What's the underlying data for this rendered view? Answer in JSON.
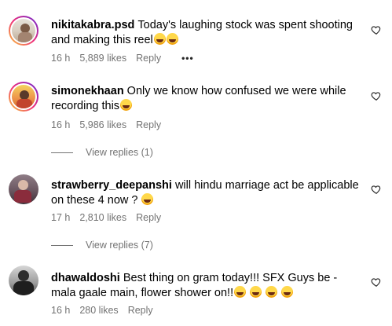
{
  "comments": [
    {
      "username": "nikitakabra.psd",
      "text": "Today's laughing stock was spent shooting and making this reel",
      "time": "16 h",
      "likes": "5,889 likes",
      "reply": "Reply",
      "more": "•••"
    },
    {
      "username": "simonekhaan",
      "text": "Only we know how confused we were while recording this",
      "time": "16 h",
      "likes": "5,986 likes",
      "reply": "Reply",
      "view_replies": "View replies (1)"
    },
    {
      "username": "strawberry_deepanshi",
      "text": "will hindu marriage act be applicable on these 4 now ?",
      "time": "17 h",
      "likes": "2,810 likes",
      "reply": "Reply",
      "view_replies": "View replies (7)"
    },
    {
      "username": "dhawaldoshi",
      "text": "Best thing on gram today!!! SFX Guys be - mala gaale main, flower shower on!!",
      "time": "16 h",
      "likes": "280 likes",
      "reply": "Reply"
    }
  ],
  "icons": {
    "like": "heart-outline-icon",
    "emoji": "laughing-emoji-icon"
  },
  "colors": {
    "secondary_text": "#737373",
    "ring_gradient": [
      "#f9ce34",
      "#ee2a7b",
      "#6228d7"
    ]
  }
}
